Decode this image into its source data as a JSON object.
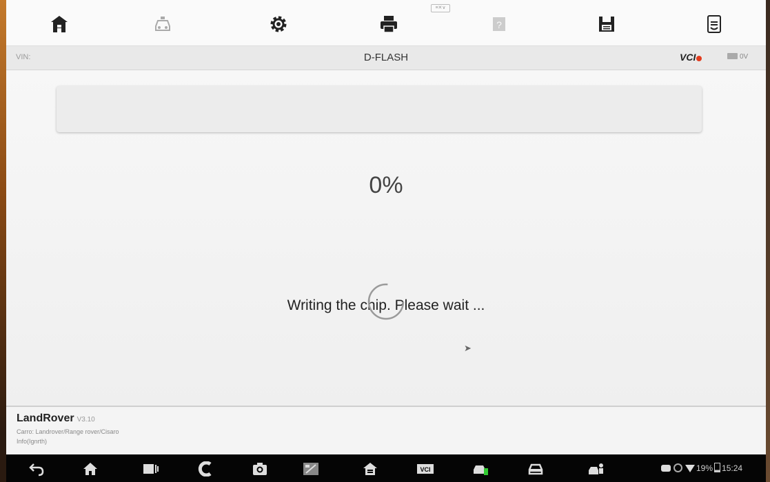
{
  "toolbar": {
    "icons": [
      "home-icon",
      "vehicle-swap-icon",
      "settings-icon",
      "print-icon",
      "help-icon",
      "save-icon",
      "data-logging-icon"
    ],
    "handle_label": "≡✕∨"
  },
  "infobar": {
    "vin_label": "VIN:",
    "title": "D-FLASH",
    "vci_label": "VCI",
    "vci_status_color": "#e23c1f",
    "battery_label": "0V"
  },
  "main": {
    "progress": 0,
    "progress_text": "0%",
    "status_text": "Writing the chip. Please wait ..."
  },
  "footer": {
    "brand": "LandRover",
    "version": "V3.10",
    "path": "Carro: Landrover/Range rover/Cisaro",
    "info": "Info(Ignrth)"
  },
  "navbar": {
    "icons": [
      "back-icon",
      "home-icon",
      "recent-apps-icon",
      "browser-icon",
      "camera-icon",
      "screen-brightness-icon",
      "maxifix-home-icon",
      "vci-manager-icon",
      "diagnostics-icon",
      "service-icon",
      "remote-desk-icon"
    ],
    "battery_percent": "19%",
    "time": "15:24"
  },
  "colors": {
    "accent": "#3aa0e0",
    "background": "#f2f2f2",
    "navbar": "#050505"
  }
}
